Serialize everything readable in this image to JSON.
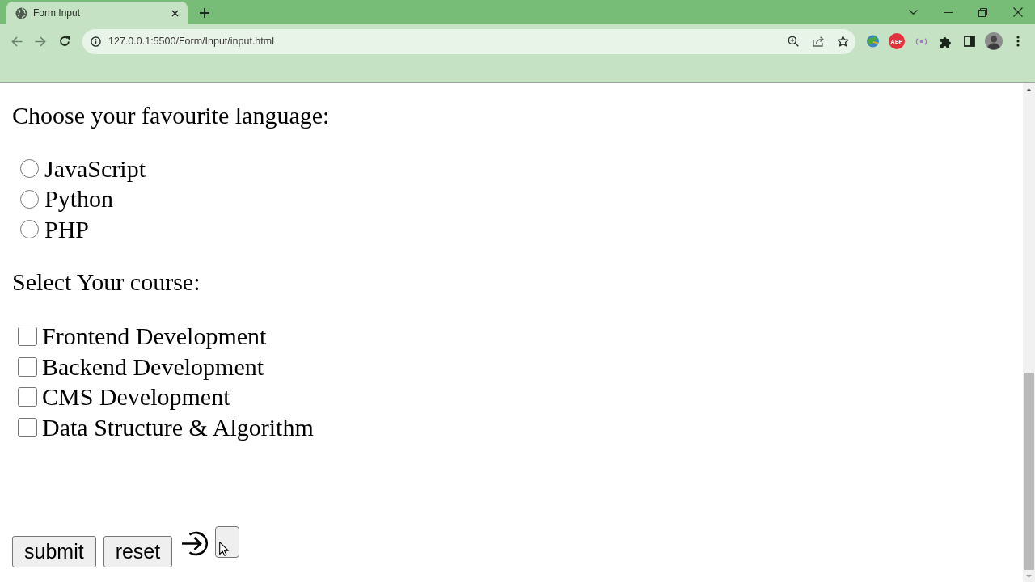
{
  "browser": {
    "tab_title": "Form Input",
    "url": "127.0.0.1:5500/Form/Input/input.html",
    "extension_badge": "ABP"
  },
  "page": {
    "language_prompt": "Choose your favourite language:",
    "languages": [
      {
        "label": "JavaScript",
        "selected": false
      },
      {
        "label": "Python",
        "selected": false
      },
      {
        "label": "PHP",
        "selected": false
      }
    ],
    "course_prompt": "Select Your course:",
    "courses": [
      {
        "label": "Frontend Development",
        "checked": false
      },
      {
        "label": "Backend Development",
        "checked": false
      },
      {
        "label": "CMS Development",
        "checked": false
      },
      {
        "label": "Data Structure & Algorithm",
        "checked": false
      }
    ],
    "buttons": [
      {
        "label": "submit"
      },
      {
        "label": "reset"
      }
    ]
  }
}
